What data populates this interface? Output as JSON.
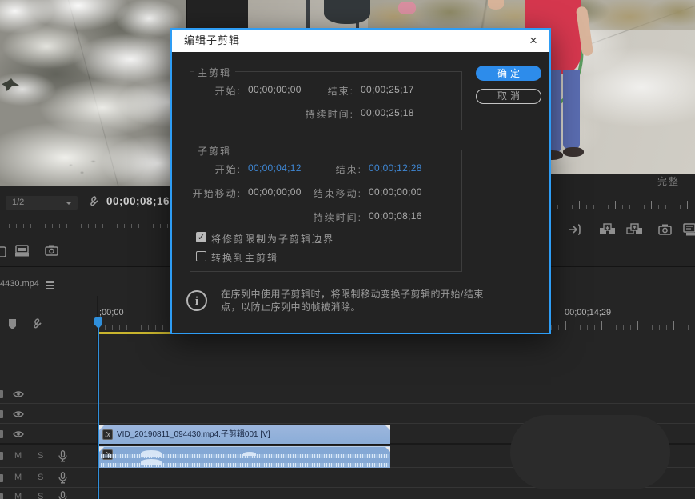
{
  "colors": {
    "accent_blue": "#2d8ceb",
    "dialog_border": "#2e9df5",
    "clip_blue": "#8badd8",
    "workbar_yellow": "#c9b52e",
    "editable_timecode_blue": "#3f87d4"
  },
  "dialog": {
    "title": "编辑子剪辑",
    "ok": "确定",
    "cancel": "取消",
    "master": {
      "legend": "主剪辑",
      "start_label": "开始:",
      "start": "00;00;00;00",
      "end_label": "结束:",
      "end": "00;00;25;17",
      "duration_label": "持续时间:",
      "duration": "00;00;25;18"
    },
    "subclip": {
      "legend": "子剪辑",
      "start_label": "开始:",
      "start": "00;00;04;12",
      "end_label": "结束:",
      "end": "00;00;12;28",
      "start_shift_label": "开始移动:",
      "start_shift": "00;00;00;00",
      "end_shift_label": "结束移动:",
      "end_shift": "00;00;00;00",
      "duration_label": "持续时间:",
      "duration": "00;00;08;16",
      "restrict_label": "将修剪限制为子剪辑边界",
      "restrict_checked": true,
      "check_glyph": "✓",
      "convert_label": "转换到主剪辑",
      "convert_checked": false
    },
    "info": "在序列中使用子剪辑时，将限制移动变换子剪辑的开始/结束点，以防止序列中的帧被消除。"
  },
  "source_monitor": {
    "zoom_level": "1/2",
    "timecode": "00;00;08;16"
  },
  "program_monitor": {
    "fit_label": "完整"
  },
  "timeline": {
    "tab_title": "4430.mp4",
    "ruler_in_label": ";00;00",
    "ruler_label": "00;00;14;29",
    "clip_label": "VID_20190811_094430.mp4.子剪辑001 [V]",
    "fx_badge": "fx",
    "audio_labels": {
      "mute": "M",
      "solo": "S"
    }
  }
}
